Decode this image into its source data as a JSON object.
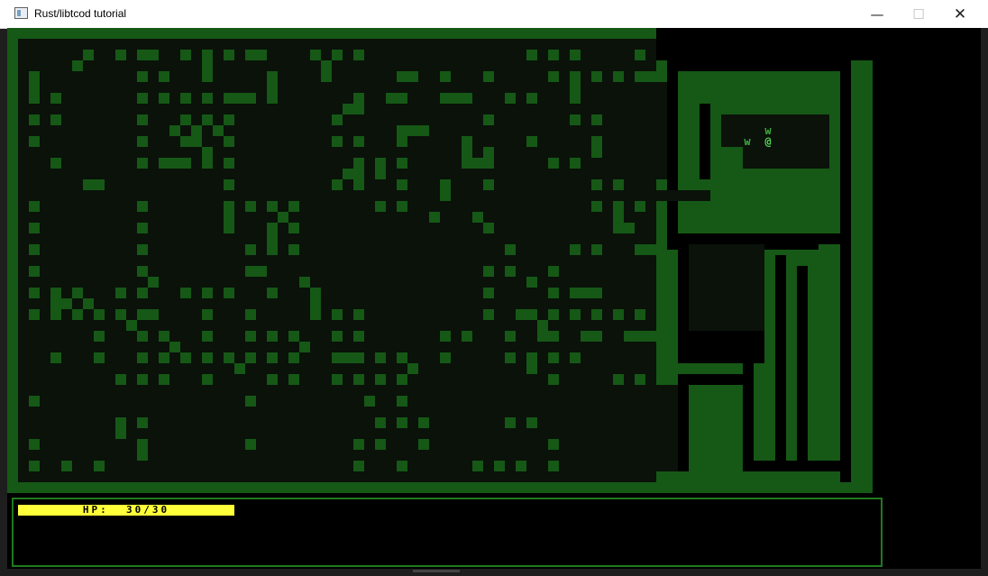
{
  "window": {
    "title": "Rust/libtcod tutorial",
    "min_glyph": "—",
    "max_glyph": "☐",
    "close_glyph": "✕",
    "icon": "window-app-icon"
  },
  "game": {
    "player_glyph": "@",
    "monsters": [
      {
        "glyph": "w"
      },
      {
        "glyph": "w"
      }
    ]
  },
  "ui": {
    "hp_label": "HP:  30/30",
    "hp_current": 30,
    "hp_max": 30
  },
  "colors": {
    "window_bg": "#000000",
    "wall_lit": "#165816",
    "ground_lit": "#0a120a",
    "wall_dark": "#0f2a0f",
    "player": "#57d657",
    "monster": "#3fae3f",
    "hp_fill": "#ffff3a",
    "hp_back": "#4a4a00",
    "panel_border": "#1f7a1f"
  }
}
